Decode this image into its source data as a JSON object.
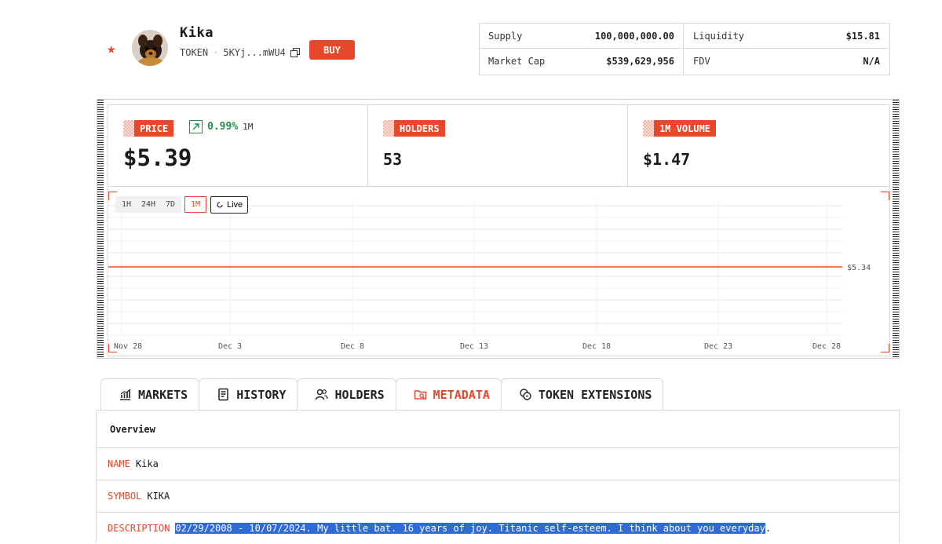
{
  "token": {
    "name": "Kika",
    "type": "TOKEN",
    "address": "5KYj...mWU4",
    "buy_label": "BUY"
  },
  "stats": [
    {
      "label": "Supply",
      "value": "100,000,000.00"
    },
    {
      "label": "Liquidity",
      "value": "$15.81"
    },
    {
      "label": "Market Cap",
      "value": "$539,629,956"
    },
    {
      "label": "FDV",
      "value": "N/A"
    }
  ],
  "metrics": {
    "price": {
      "label": "PRICE",
      "value": "$5.39",
      "change": "0.99%",
      "period": "1M"
    },
    "holders": {
      "label": "HOLDERS",
      "value": "53"
    },
    "volume": {
      "label": "1M VOLUME",
      "value": "$1.47"
    }
  },
  "chart_controls": {
    "ranges": [
      "1H",
      "24H",
      "7D",
      "1M"
    ],
    "active_range": "1M",
    "live_label": "Live"
  },
  "chart_data": {
    "type": "line",
    "x": [
      "Nov 28",
      "Dec 3",
      "Dec 8",
      "Dec 13",
      "Dec 18",
      "Dec 23",
      "Dec 28"
    ],
    "series": [
      {
        "values": [
          5.34,
          5.34,
          5.34,
          5.34,
          5.34,
          5.34,
          5.34
        ]
      }
    ],
    "last_price_label": "$5.34",
    "xlabel": "",
    "ylabel": "",
    "grid": true,
    "color": "#e5482a"
  },
  "tabs": [
    {
      "label": "MARKETS",
      "icon": "chart-bars-icon"
    },
    {
      "label": "HISTORY",
      "icon": "document-icon"
    },
    {
      "label": "HOLDERS",
      "icon": "users-icon"
    },
    {
      "label": "METADATA",
      "icon": "folder-search-icon",
      "active": true
    },
    {
      "label": "TOKEN EXTENSIONS",
      "icon": "coins-icon"
    }
  ],
  "metadata": {
    "section_title": "Overview",
    "name_label": "NAME",
    "name_value": "Kika",
    "symbol_label": "SYMBOL",
    "symbol_value": "KIKA",
    "description_label": "DESCRIPTION",
    "description_selected": "02/29/2008 - 10/07/2024. My little bat. 16 years of joy. Titanic self-esteem. I think about you everyday",
    "description_tail": "."
  },
  "colors": {
    "accent": "#e5482a",
    "positive": "#1f8f4a",
    "selection": "#2f6bd6"
  }
}
